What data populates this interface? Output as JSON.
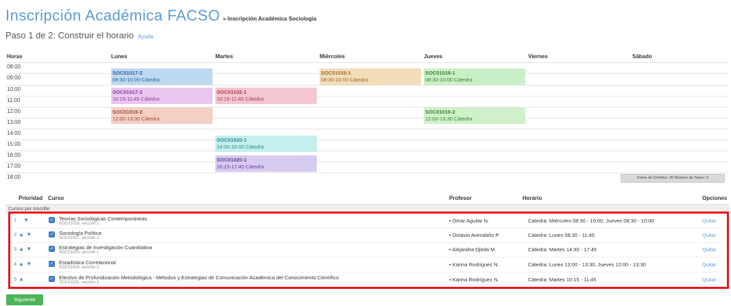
{
  "header": {
    "title": "Inscripción Académica FACSO",
    "subtitle": "» Inscripción Académica Sociología",
    "step": "Paso 1 de 2: Construir el horario",
    "help_link": "Ayuda"
  },
  "schedule": {
    "columns": [
      "Horas",
      "Lunes",
      "Martes",
      "Miércoles",
      "Jueves",
      "Viernes",
      "Sábado"
    ],
    "hours": [
      "08:00",
      "09:00",
      "10:00",
      "11:00",
      "12:00",
      "13:00",
      "14:00",
      "15:00",
      "16:00",
      "17:00",
      "18:00"
    ],
    "blocks": [
      {
        "code": "SOC01017-2",
        "time": "08:30-10:00 Cátedra",
        "color": "#bcd9f0",
        "text_color": "#2b5fa3"
      },
      {
        "code": "SOC01016-1",
        "time": "08:30-10:00 Cátedra",
        "color": "#f3dcb9",
        "text_color": "#9a6a25"
      },
      {
        "code": "SOC01016-1",
        "time": "08:30-10:00 Cátedra",
        "color": "#c9efc6",
        "text_color": "#3a7d34"
      },
      {
        "code": "SOC01017-2",
        "time": "10:15-11:45 Cátedra",
        "color": "#e9c6ef",
        "text_color": "#8a3a9a"
      },
      {
        "code": "SOC01102-1",
        "time": "10:15-11:45 Cátedra",
        "color": "#f4c6cf",
        "text_color": "#a43a52"
      },
      {
        "code": "SOC01019-2",
        "time": "12:00-13:30 Cátedra",
        "color": "#f3cfc5",
        "text_color": "#a8482d"
      },
      {
        "code": "SOC01019-2",
        "time": "12:00-13:30 Cátedra",
        "color": "#cff0c8",
        "text_color": "#3a7d34"
      },
      {
        "code": "SOC01020-1",
        "time": "14:30-16:00 Cátedra",
        "color": "#c3efee",
        "text_color": "#2c8b88"
      },
      {
        "code": "SOC01020-1",
        "time": "16:15-17:45 Cátedra",
        "color": "#d6caf0",
        "text_color": "#5b3d9e"
      }
    ],
    "credits_summary": "Suma de Créditos: 26  Número de Topes: 0"
  },
  "courses": {
    "headers": {
      "priority": "Prioridad",
      "course": "Curso",
      "professor": "Profesor",
      "schedule": "Horario",
      "options": "Opciones"
    },
    "section_label": "Cursos por Inscribir",
    "rows": [
      {
        "priority": "1",
        "name": "Teorías Sociológicas Contemporáneas",
        "sub": "SOC01016, sección 1",
        "professor": "Omar Aguilar N.",
        "schedule": "Cátedra: Miércoles 08:30 - 10:00, Jueves 08:30 - 10:00",
        "action": "Quitar"
      },
      {
        "priority": "2",
        "name": "Sociología Política",
        "sub": "SOC01017, sección 2",
        "professor": "Octavio Avendaño P.",
        "schedule": "Cátedra: Lunes 08:30 - 11:45",
        "action": "Quitar"
      },
      {
        "priority": "3",
        "name": "Estrategias de Investigación Cuantitativa",
        "sub": "SOC01020, sección 1",
        "professor": "Alejandra Ojeda M.",
        "schedule": "Cátedra: Martes 14:30 - 17:45",
        "action": "Quitar"
      },
      {
        "priority": "4",
        "name": "Estadística Correlacional",
        "sub": "SOC01019, sección 2",
        "professor": "Karina Rodríguez N.",
        "schedule": "Cátedra: Lunes 12:00 - 13:30, Jueves 12:00 - 13:30",
        "action": "Quitar"
      },
      {
        "priority": "5",
        "name": "Electivo de Profundización Metodológica - Métodos y Estrategias de Comunicación Académica del Conocimiento Científico",
        "sub": "SOC01102, sección 1",
        "professor": "Karina Rodríguez N.",
        "schedule": "Cátedra: Martes 10:15 - 11:45",
        "action": "Quitar"
      }
    ]
  },
  "footer": {
    "next_button": "Siguiente"
  },
  "icons": {
    "checkbox": "check-icon",
    "up": "up-arrow-icon",
    "down": "down-arrow-icon",
    "bullet": "bullet-icon"
  }
}
